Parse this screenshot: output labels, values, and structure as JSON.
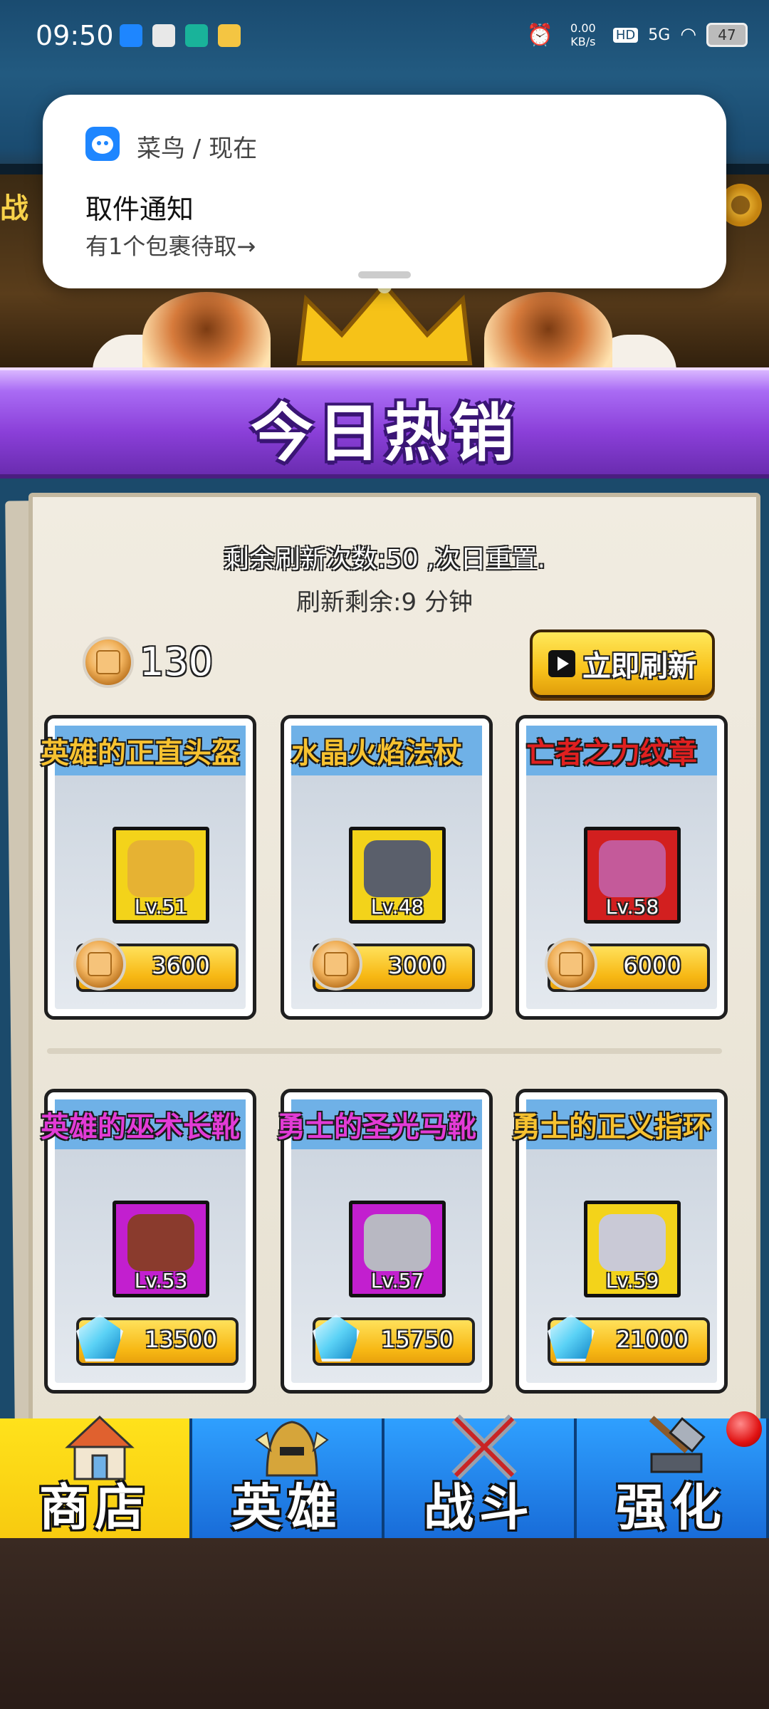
{
  "status_bar": {
    "time": "09:50",
    "net_speed": "0.00 KB/s",
    "hd": "HD",
    "signal": "5G",
    "battery": "47"
  },
  "notification": {
    "app": "菜鸟 / 现在",
    "title": "取件通知",
    "body": "有1个包裹待取→"
  },
  "banner": {
    "title": "今日热销"
  },
  "shop": {
    "refresh_count_text": "剩余刷新次数:50 ,次日重置.",
    "refresh_timer_text": "刷新剩余:9 分钟",
    "coins": "130",
    "refresh_button": "立即刷新",
    "items": [
      {
        "name": "英雄的正直头盔",
        "level": "Lv.51",
        "price": "3600",
        "currency": "coin",
        "name_color": "#f7c230",
        "frame_color": "#f3d31a",
        "art_color": "#e6b233"
      },
      {
        "name": "水晶火焰法杖",
        "level": "Lv.48",
        "price": "3000",
        "currency": "coin",
        "name_color": "#f7c230",
        "frame_color": "#f3d31a",
        "art_color": "#5a5f6b"
      },
      {
        "name": "亡者之力纹章",
        "level": "Lv.58",
        "price": "6000",
        "currency": "coin",
        "name_color": "#e02020",
        "frame_color": "#d21f1f",
        "art_color": "#c45a9a"
      },
      {
        "name": "英雄的巫术长靴",
        "level": "Lv.53",
        "price": "13500",
        "currency": "gem",
        "name_color": "#e23bd6",
        "frame_color": "#c21fcf",
        "art_color": "#8a3b2d"
      },
      {
        "name": "勇士的圣光马靴",
        "level": "Lv.57",
        "price": "15750",
        "currency": "gem",
        "name_color": "#e23bd6",
        "frame_color": "#c21fcf",
        "art_color": "#b8b8c2"
      },
      {
        "name": "勇士的正义指环",
        "level": "Lv.59",
        "price": "21000",
        "currency": "gem",
        "name_color": "#f7c230",
        "frame_color": "#f3d31a",
        "art_color": "#c9c9d6"
      }
    ]
  },
  "nav": [
    {
      "label": "商店",
      "active": true
    },
    {
      "label": "英雄",
      "active": false
    },
    {
      "label": "战斗",
      "active": false
    },
    {
      "label": "强化",
      "active": false,
      "badge": true
    }
  ]
}
